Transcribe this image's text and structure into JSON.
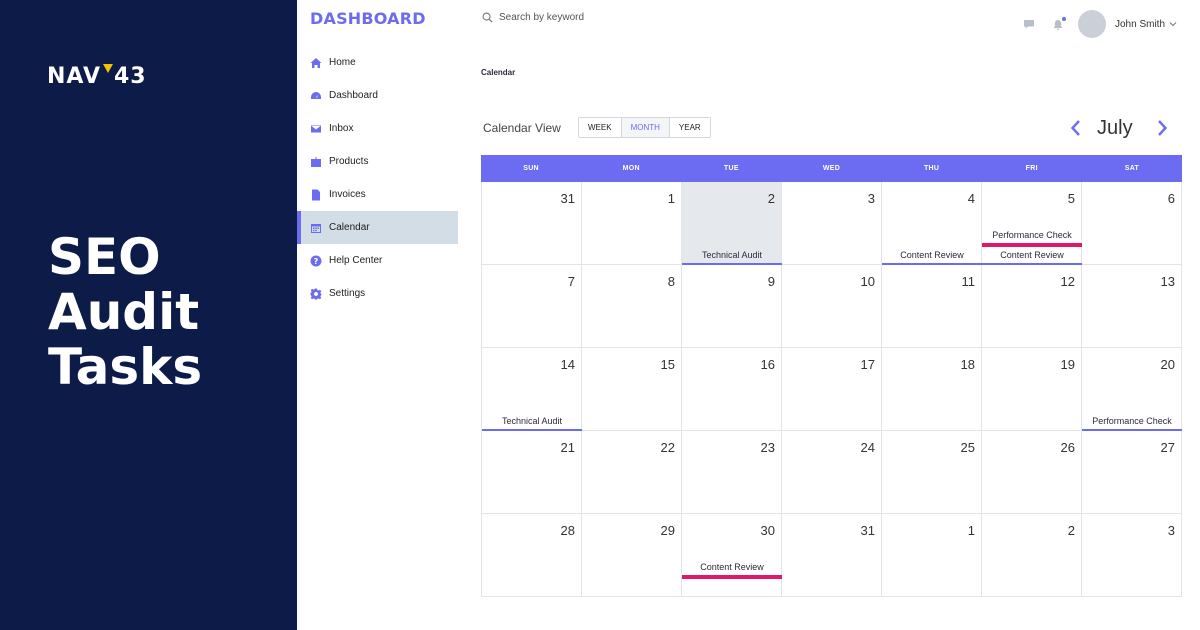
{
  "brand": {
    "logo_left": "NAV",
    "logo_right": "43",
    "headline": [
      "SEO",
      "Audit",
      "Tasks"
    ]
  },
  "app": {
    "title": "DASHBOARD"
  },
  "sidebar": {
    "items": [
      {
        "label": "Home",
        "icon": "home-icon"
      },
      {
        "label": "Dashboard",
        "icon": "gauge-icon"
      },
      {
        "label": "Inbox",
        "icon": "mail-icon"
      },
      {
        "label": "Products",
        "icon": "box-icon"
      },
      {
        "label": "Invoices",
        "icon": "document-icon"
      },
      {
        "label": "Calendar",
        "icon": "calendar-icon",
        "active": true
      },
      {
        "label": "Help Center",
        "icon": "help-icon"
      },
      {
        "label": "Settings",
        "icon": "gear-icon"
      }
    ]
  },
  "topbar": {
    "search_placeholder": "Search by keyword",
    "user_name": "John Smith"
  },
  "breadcrumb": "Calendar",
  "calendar": {
    "view_label": "Calendar View",
    "views": [
      "WEEK",
      "MONTH",
      "YEAR"
    ],
    "active_view": "MONTH",
    "month": "July",
    "weekdays": [
      "SUN",
      "MON",
      "TUE",
      "WED",
      "THU",
      "FRI",
      "SAT"
    ],
    "days": [
      "31",
      "1",
      "2",
      "3",
      "4",
      "5",
      "6",
      "7",
      "8",
      "9",
      "10",
      "11",
      "12",
      "13",
      "14",
      "15",
      "16",
      "17",
      "18",
      "19",
      "20",
      "21",
      "22",
      "23",
      "24",
      "25",
      "26",
      "27",
      "28",
      "29",
      "30",
      "31",
      "1",
      "2",
      "3"
    ],
    "today_index": 2,
    "events": [
      {
        "day_index": 2,
        "title": "Technical Audit",
        "color": "#6c6cf2",
        "row": "low"
      },
      {
        "day_index": 4,
        "title": "Content Review",
        "color": "#6c6cf2",
        "row": "low"
      },
      {
        "day_index": 5,
        "title": "Content Review",
        "color": "#6c6cf2",
        "row": "low"
      },
      {
        "day_index": 5,
        "title": "Performance Check",
        "color": "#e0176b",
        "row": "high"
      },
      {
        "day_index": 14,
        "title": "Technical Audit",
        "color": "#6c6cf2",
        "row": "low"
      },
      {
        "day_index": 20,
        "title": "Performance Check",
        "color": "#6c6cf2",
        "row": "low"
      },
      {
        "day_index": 30,
        "title": "Content Review",
        "color": "#e0176b",
        "row": "high"
      }
    ]
  },
  "colors": {
    "brand_bg": "#0c1b47",
    "accent": "#6c6cf2",
    "highlight": "#e0176b",
    "logo_mark": "#f2c200"
  }
}
